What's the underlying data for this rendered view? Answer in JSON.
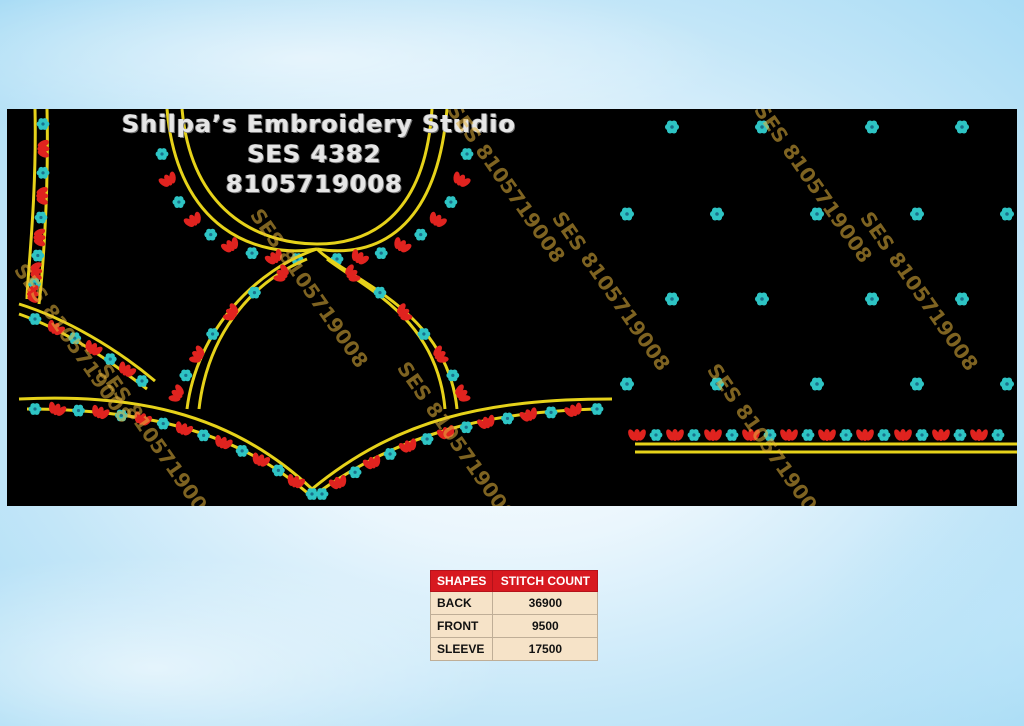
{
  "studio": {
    "name": "Shilpa’s Embroidery Studio",
    "code": "SES 4382",
    "phone": "8105719008"
  },
  "watermark": {
    "text": "SES 8105719008"
  },
  "stitch_table": {
    "headers": [
      "SHAPES",
      "STITCH COUNT"
    ],
    "rows": [
      {
        "shape": "BACK",
        "count": "36900"
      },
      {
        "shape": "FRONT",
        "count": "9500"
      },
      {
        "shape": "SLEEVE",
        "count": "17500"
      }
    ]
  },
  "colors": {
    "background_panel": "#000000",
    "outline_yellow": "#e6d21a",
    "flower_cyan": "#2ec4c4",
    "leaf_red": "#e0231f",
    "table_header": "#d71920",
    "table_cell": "#f6e3c8"
  },
  "icons": [
    "flower-motif-icon",
    "leaf-motif-icon"
  ]
}
